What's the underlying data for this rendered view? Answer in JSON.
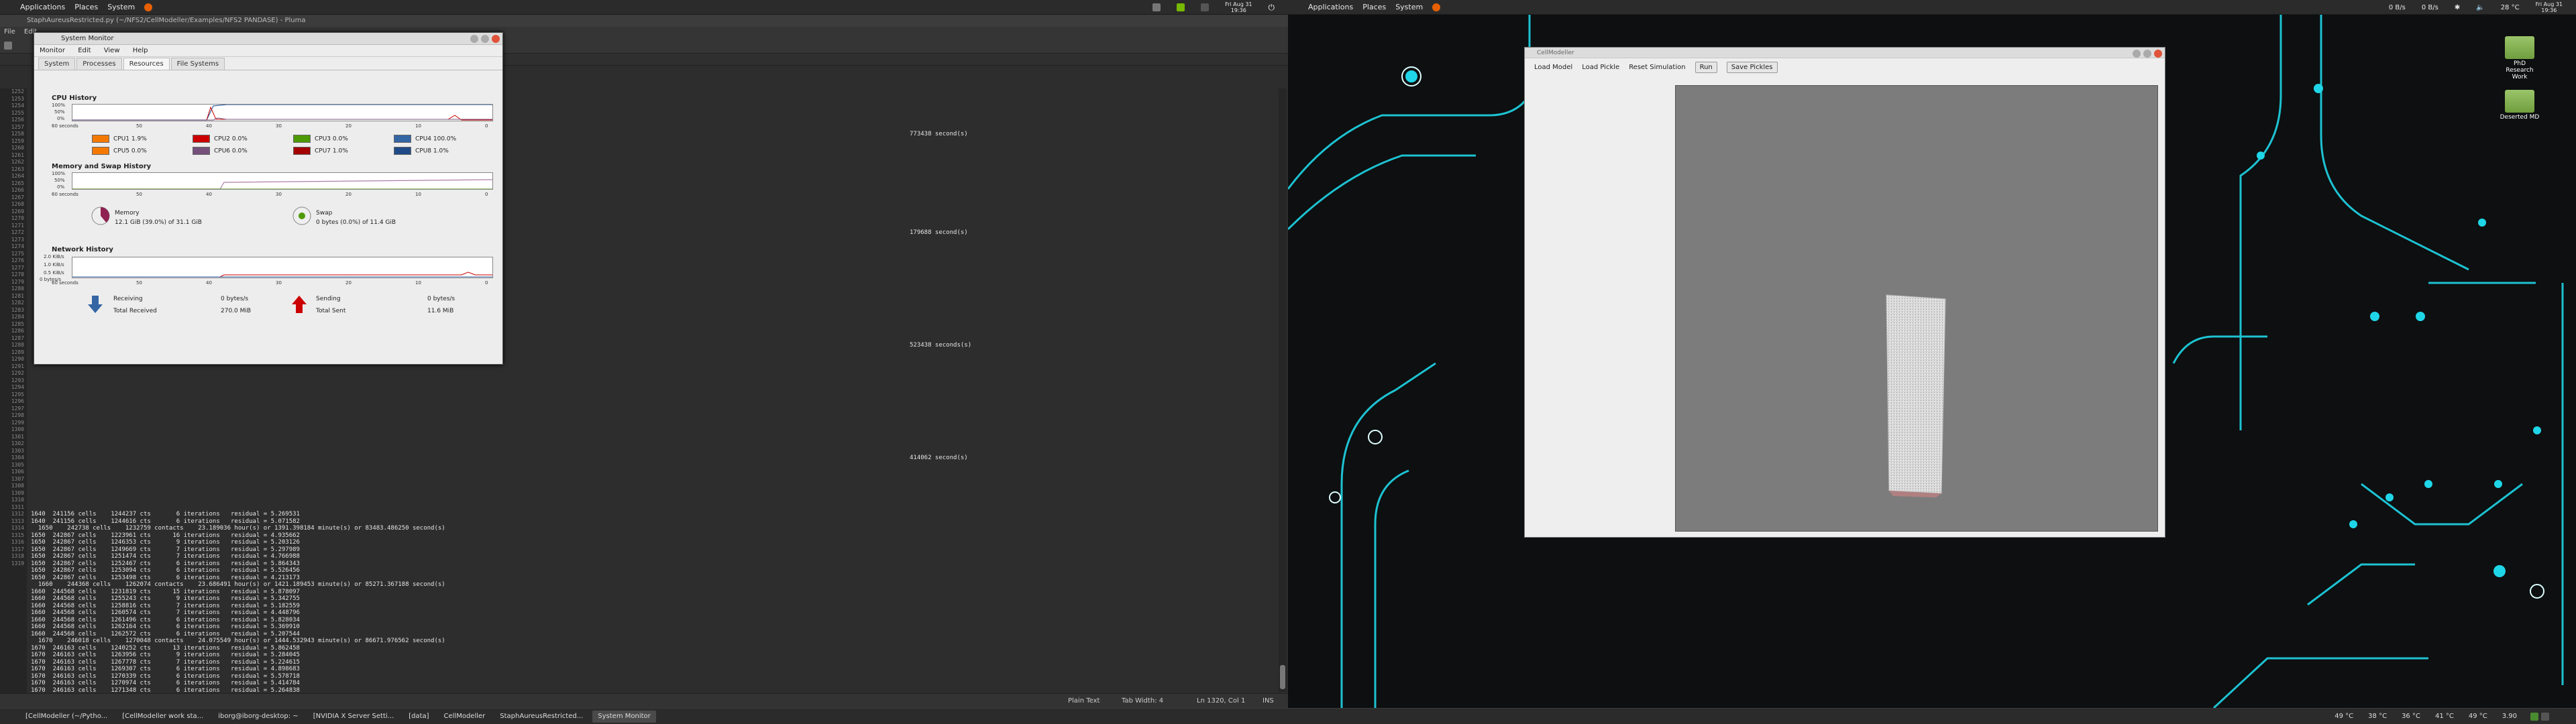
{
  "left_panel": {
    "menus": [
      "Applications",
      "Places",
      "System"
    ],
    "clock": "Fri Aug 31\n19:36"
  },
  "right_panel": {
    "menus": [
      "Applications",
      "Places",
      "System"
    ],
    "net_down": "0 B/s",
    "net_up": "0 B/s",
    "temp": "28 °C",
    "clock": "Fri Aug 31\n19:36"
  },
  "editor": {
    "title": "StaphAureusRestricted.py (~/NFS2/CellModeller/Examples/NFS2 PANDASE) - Pluma",
    "menus": [
      "File",
      "Edit"
    ],
    "status": {
      "language": "Plain Text",
      "tab_width": "Tab Width: 4",
      "position": "Ln 1320, Col 1",
      "mode": "INS"
    },
    "line_numbers": [
      "1252",
      "1253",
      "1254",
      "1255",
      "1256",
      "1257",
      "1258",
      "1259",
      "1260",
      "1261",
      "1262",
      "1263",
      "1264",
      "1265",
      "1266",
      "1267",
      "1268",
      "1269",
      "1270",
      "1271",
      "1272",
      "1273",
      "1274",
      "1275",
      "1276",
      "1277",
      "1278",
      "1279",
      "1280",
      "1281",
      "1282",
      "1283",
      "1284",
      "1285",
      "1286",
      "1287",
      "1288",
      "1289",
      "1290",
      "1291",
      "1292",
      "1293",
      "1294",
      "1295",
      "1296",
      "1297",
      "1298",
      "1299",
      "1300",
      "1301",
      "1302",
      "1303",
      "1304",
      "1305",
      "1306",
      "1307",
      "1308",
      "1309",
      "1310",
      "1311",
      "1312",
      "1313",
      "1314",
      "1315",
      "1316",
      "1317",
      "1318",
      "1319"
    ],
    "code_lines": [
      "",
      "",
      "",
      "",
      "",
      "",
      "773438 second(s)",
      "",
      "",
      "",
      "",
      "",
      "",
      "",
      "",
      "",
      "",
      "",
      "",
      "",
      "179688 second(s)",
      "",
      "",
      "",
      "",
      "",
      "",
      "",
      "",
      "",
      "",
      "",
      "",
      "",
      "",
      "",
      "523438 seconds(s)",
      "",
      "",
      "",
      "",
      "",
      "",
      "",
      "",
      "",
      "",
      "",
      "",
      "",
      "",
      "",
      "414062 second(s)",
      "",
      "",
      "",
      "",
      "",
      "",
      "",
      "1640  241156 cells    1244237 cts       6 iterations   residual = 5.269531",
      "1640  241156 cells    1244616 cts       6 iterations   residual = 5.071582",
      "  1650    242738 cells    1232759 contacts    23.189036 hour(s) or 1391.398184 minute(s) or 83483.486250 second(s)",
      "1650  242867 cells    1223961 cts      16 iterations   residual = 4.935662",
      "1650  242867 cells    1246353 cts       9 iterations   residual = 5.203126",
      "1650  242867 cells    1249669 cts       7 iterations   residual = 5.297989",
      "1650  242867 cells    1251474 cts       7 iterations   residual = 4.766988",
      "1650  242867 cells    1252467 cts       6 iterations   residual = 5.864343",
      "1650  242867 cells    1253094 cts       6 iterations   residual = 5.526456",
      "1650  242867 cells    1253498 cts       6 iterations   residual = 4.213173",
      "  1660    244368 cells    1262074 contacts    23.686491 hour(s) or 1421.189453 minute(s) or 85271.367188 second(s)",
      "1660  244568 cells    1231819 cts      15 iterations   residual = 5.878097",
      "1660  244568 cells    1255243 cts       9 iterations   residual = 5.342755",
      "1660  244568 cells    1258816 cts       7 iterations   residual = 5.182559",
      "1660  244568 cells    1260574 cts       7 iterations   residual = 4.448796",
      "1660  244568 cells    1261496 cts       6 iterations   residual = 5.828034",
      "1660  244568 cells    1262164 cts       6 iterations   residual = 5.369910",
      "1660  244568 cells    1262572 cts       6 iterations   residual = 5.207544",
      "  1670    246018 cells    1270048 contacts    24.075549 hour(s) or 1444.532943 minute(s) or 86671.976562 second(s)",
      "1670  246163 cells    1240252 cts      13 iterations   residual = 5.862458",
      "1670  246163 cells    1263956 cts       9 iterations   residual = 5.284045",
      "1670  246163 cells    1267778 cts       7 iterations   residual = 5.224615",
      "1670  246163 cells    1269307 cts       6 iterations   residual = 4.898683",
      "1670  246163 cells    1270339 cts       6 iterations   residual = 5.578718",
      "1670  246163 cells    1270974 cts       6 iterations   residual = 5.414784",
      "1670  246163 cells    1271348 cts       6 iterations   residual = 5.264838",
      "  1680    247781 cells    1279581 contacts    24.574408 hour(s) or 1474.464453 minute(s) or 88467.867188 second(s)",
      "1680  247881 cells    1248694 cts      13 iterations   residual = 6.132578",
      "1680  247881 cells    1272675 cts       9 iterations   residual = 5.480867",
      "1680  247881 cells    1276884 cts       7 iterations   residual = 5.151648",
      "1680  247881 cells    1278009 cts       7 iterations   residual = 4.922418",
      "1680  247881 cells    1279035 cts       6 iterations   residual = 5.695987",
      "1680  247881 cells    1279702 cts       6 iterations   residual = 5.317217",
      "1680  247881 cells    1280098 cts       6 iterations   residual = 5.387141",
      ""
    ]
  },
  "system_monitor": {
    "title": "System Monitor",
    "menus": [
      "Monitor",
      "Edit",
      "View",
      "Help"
    ],
    "tabs": [
      "System",
      "Processes",
      "Resources",
      "File Systems"
    ],
    "cpu": {
      "title": "CPU History",
      "y_ticks": [
        "100%",
        "50%",
        "0%"
      ],
      "x_ticks": [
        "60 seconds",
        "50",
        "40",
        "30",
        "20",
        "10",
        "0"
      ],
      "legend": [
        {
          "label": "CPU1",
          "value": "1.9%",
          "color": "#f57900"
        },
        {
          "label": "CPU2",
          "value": "0.0%",
          "color": "#cc0000"
        },
        {
          "label": "CPU3",
          "value": "0.0%",
          "color": "#4e9a06"
        },
        {
          "label": "CPU4",
          "value": "100.0%",
          "color": "#3465a4"
        },
        {
          "label": "CPU5",
          "value": "0.0%",
          "color": "#f57900"
        },
        {
          "label": "CPU6",
          "value": "0.0%",
          "color": "#75507b"
        },
        {
          "label": "CPU7",
          "value": "1.0%",
          "color": "#a40000"
        },
        {
          "label": "CPU8",
          "value": "1.0%",
          "color": "#204a87"
        }
      ]
    },
    "memory": {
      "title": "Memory and Swap History",
      "y_ticks": [
        "100%",
        "50%",
        "0%"
      ],
      "x_ticks": [
        "60 seconds",
        "50",
        "40",
        "30",
        "20",
        "10",
        "0"
      ],
      "mem_label": "Memory",
      "mem_value": "12.1 GiB (39.0%) of 31.1 GiB",
      "mem_fraction": 0.39,
      "swap_label": "Swap",
      "swap_value": "0 bytes (0.0%) of 11.4 GiB"
    },
    "network": {
      "title": "Network History",
      "y_ticks": [
        "2.0 KiB/s",
        "1.0 KiB/s",
        "0.5 KiB/s",
        "0 bytes/s"
      ],
      "x_ticks": [
        "60 seconds",
        "50",
        "40",
        "30",
        "20",
        "10",
        "0"
      ],
      "receiving": "Receiving",
      "receiving_rate": "0 bytes/s",
      "total_received_label": "Total Received",
      "total_received": "270.0 MiB",
      "sending": "Sending",
      "sending_rate": "0 bytes/s",
      "total_sent_label": "Total Sent",
      "total_sent": "11.6 MiB"
    }
  },
  "cellmodeller": {
    "title": "CellModeller",
    "buttons": [
      "Load Model",
      "Load Pickle",
      "Reset Simulation"
    ],
    "run": "Run",
    "save": "Save Pickles"
  },
  "desktop_icons": [
    {
      "label": "PhD Research Work"
    },
    {
      "label": "Deserted MD"
    }
  ],
  "left_taskbar": [
    {
      "label": "[CellModeller (~/Pytho..."
    },
    {
      "label": "[CellModeller work sta..."
    },
    {
      "label": "iborg@iborg-desktop: ~"
    },
    {
      "label": "[NVIDIA X Server Setti..."
    },
    {
      "label": "[data]"
    },
    {
      "label": "CellModeller"
    },
    {
      "label": "StaphAureusRestricted..."
    },
    {
      "label": "System Monitor"
    }
  ],
  "right_taskbar": {
    "temps": [
      "49 °C",
      "38 °C",
      "36 °C",
      "41 °C",
      "49 °C",
      "3.90"
    ]
  }
}
